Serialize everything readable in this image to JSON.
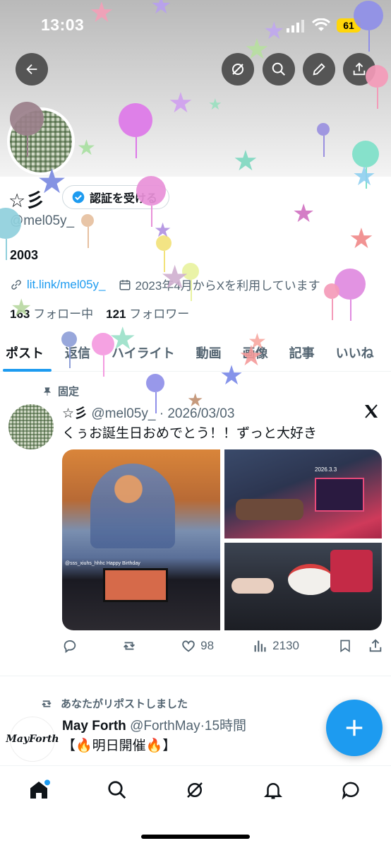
{
  "status_bar": {
    "time": "13:03",
    "battery": "61"
  },
  "profile": {
    "name": "☆彡",
    "verify_label": "認証を受ける",
    "handle": "@mel05y_",
    "bio": "2003",
    "link": "lit.link/mel05y_",
    "joined": "2023年4月からXを利用しています",
    "following_count": "163",
    "following_label": "フォロー中",
    "followers_count": "121",
    "followers_label": "フォロワー"
  },
  "tabs": [
    "ポスト",
    "返信",
    "ハイライト",
    "動画",
    "画像",
    "記事",
    "いいね"
  ],
  "pinned_post": {
    "pinned_label": "固定",
    "name": "☆彡",
    "handle": "@mel05y_",
    "date": "2026/03/03",
    "text": "くぅお誕生日おめでとう！！ずっと大好き",
    "media_caption": "@sss_xiuhs_hhhc Happy Birthday",
    "media_date": "2026.3.3",
    "reply_count": "",
    "repost_count": "",
    "like_count": "98",
    "view_count": "2130"
  },
  "repost": {
    "note": "あなたがリポストしました",
    "name": "May Forth",
    "handle": "@ForthMay",
    "time": "15時間",
    "logo_text": "MayForth",
    "text": "【🔥明日開催🔥】"
  },
  "colors": {
    "accent": "#1d9bf0",
    "text": "#0f1419",
    "muted": "#536471"
  }
}
